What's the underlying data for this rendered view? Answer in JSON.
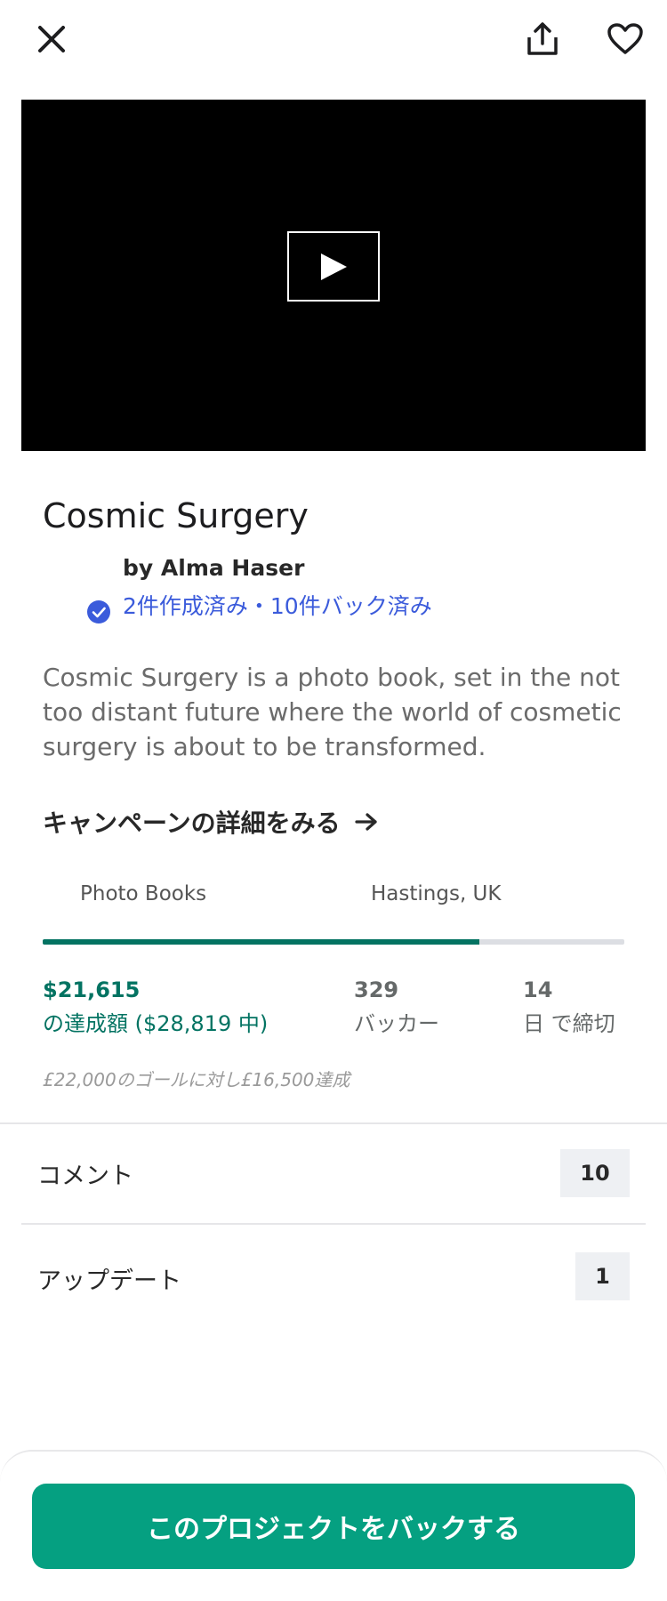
{
  "project": {
    "title": "Cosmic Surgery",
    "creator": "by Alma Haser",
    "creator_stats": "2件作成済み・10件バック済み",
    "blurb": "Cosmic Surgery is a photo book, set in the not too distant future where the world of cosmetic surgery is about to be transformed.",
    "details_link": "キャンペーンの詳細をみる",
    "category": "Photo Books",
    "location": "Hastings, UK"
  },
  "stats": {
    "funding_progress_fraction": 0.75,
    "pledged_amount": "$21,615",
    "pledged_label": "の達成額 ($28,819 中)",
    "backers_count": "329",
    "backers_label": "バッカー",
    "days_left": "14",
    "days_label": "日 で締切",
    "goal_note": "£22,000のゴールに対し£16,500達成"
  },
  "rows": {
    "comments_label": "コメント",
    "comments_count": "10",
    "updates_label": "アップデート",
    "updates_count": "1"
  },
  "cta": {
    "back_label": "このプロジェクトをバックする"
  },
  "colors": {
    "accent_green": "#037362",
    "button_green": "#05a081",
    "link_blue": "#3b5bdb"
  },
  "icons": {
    "close": "close-icon",
    "share": "share-icon",
    "favorite": "heart-icon",
    "play": "play-icon",
    "verified": "verified-check-icon",
    "arrow": "arrow-right-icon"
  }
}
